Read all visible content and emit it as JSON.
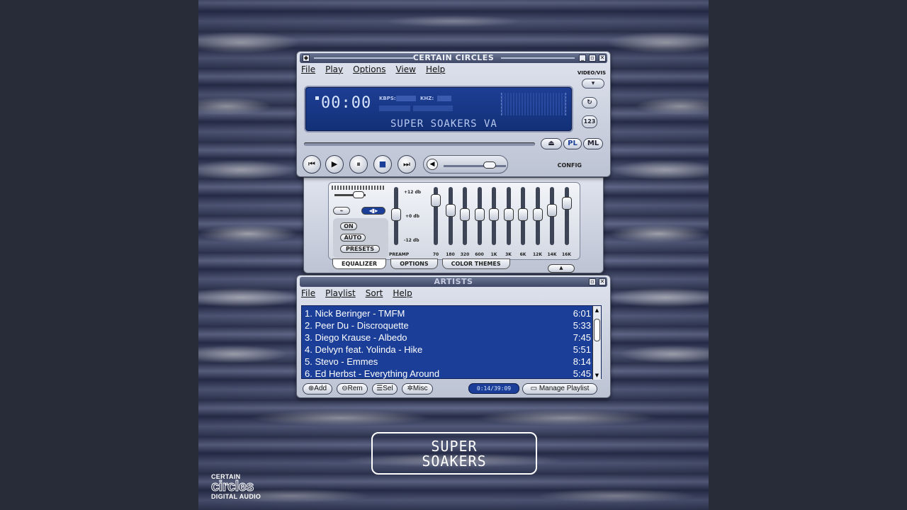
{
  "main": {
    "title": "CERTAIN CIRCLES",
    "menu": [
      "File",
      "Play",
      "Options",
      "View",
      "Help"
    ],
    "video_vis": "VIDEO/VIS",
    "time": "00:00",
    "kbps_label": "KBPS:",
    "khz_label": "KHZ:",
    "marquee": "SUPER SOAKERS VA",
    "eject": "⏏",
    "pl_btn": "PL",
    "ml_btn": "ML",
    "config": "CONFIG"
  },
  "equalizer": {
    "on": "ON",
    "auto": "AUTO",
    "presets": "PRESETS",
    "db_plus": "+12 db",
    "db_zero": "+0 db",
    "db_minus": "-12 db",
    "bands": [
      "PREAMP",
      "70",
      "180",
      "320",
      "600",
      "1K",
      "3K",
      "6K",
      "12K",
      "14K",
      "16K"
    ],
    "tabs": [
      "EQUALIZER",
      "OPTIONS",
      "COLOR THEMES"
    ]
  },
  "playlist": {
    "title": "ARTISTS",
    "menu": [
      "File",
      "Playlist",
      "Sort",
      "Help"
    ],
    "tracks": [
      {
        "name": "1. Nick Beringer - TMFM",
        "duration": "6:01"
      },
      {
        "name": "2. Peer Du - Discroquette",
        "duration": "5:33"
      },
      {
        "name": "3. Diego Krause - Albedo",
        "duration": "7:45"
      },
      {
        "name": "4. Delvyn feat. Yolinda - Hike",
        "duration": "5:51"
      },
      {
        "name": "5. Stevo - Emmes",
        "duration": "8:14"
      },
      {
        "name": "6. Ed Herbst - Everything Around",
        "duration": "5:45"
      }
    ],
    "add": "Add",
    "rem": "Rem",
    "sel": "Sel",
    "misc": "Misc",
    "time_display": "0:14/39:09",
    "manage": "Manage Playlist"
  },
  "cover": {
    "line1": "SUPER",
    "line2": "SOAKERS",
    "logo_top": "CERTAIN",
    "logo_mid": "circles",
    "logo_bottom": "DIGITAL AUDIO"
  }
}
